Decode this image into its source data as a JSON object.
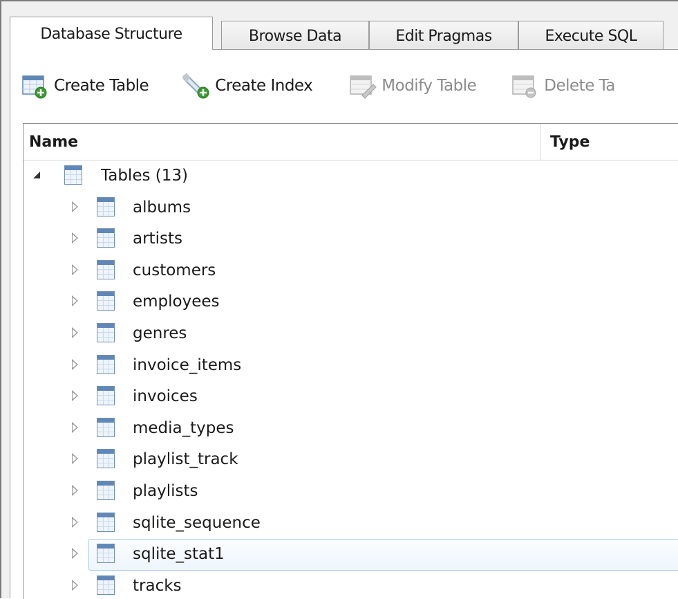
{
  "tabs": [
    {
      "label": "Database Structure",
      "active": true
    },
    {
      "label": "Browse Data",
      "active": false
    },
    {
      "label": "Edit Pragmas",
      "active": false
    },
    {
      "label": "Execute SQL",
      "active": false
    }
  ],
  "toolbar": {
    "create_table": "Create Table",
    "create_index": "Create Index",
    "modify_table": "Modify Table",
    "delete_table": "Delete Ta"
  },
  "tree": {
    "columns": {
      "name": "Name",
      "type": "Type"
    },
    "root_label": "Tables (13)",
    "tables": [
      "albums",
      "artists",
      "customers",
      "employees",
      "genres",
      "invoice_items",
      "invoices",
      "media_types",
      "playlist_track",
      "playlists",
      "sqlite_sequence",
      "sqlite_stat1",
      "tracks"
    ],
    "selected": "sqlite_stat1"
  },
  "colors": {
    "accent": "#5f87b8",
    "selection_border": "#a9c8ea"
  }
}
